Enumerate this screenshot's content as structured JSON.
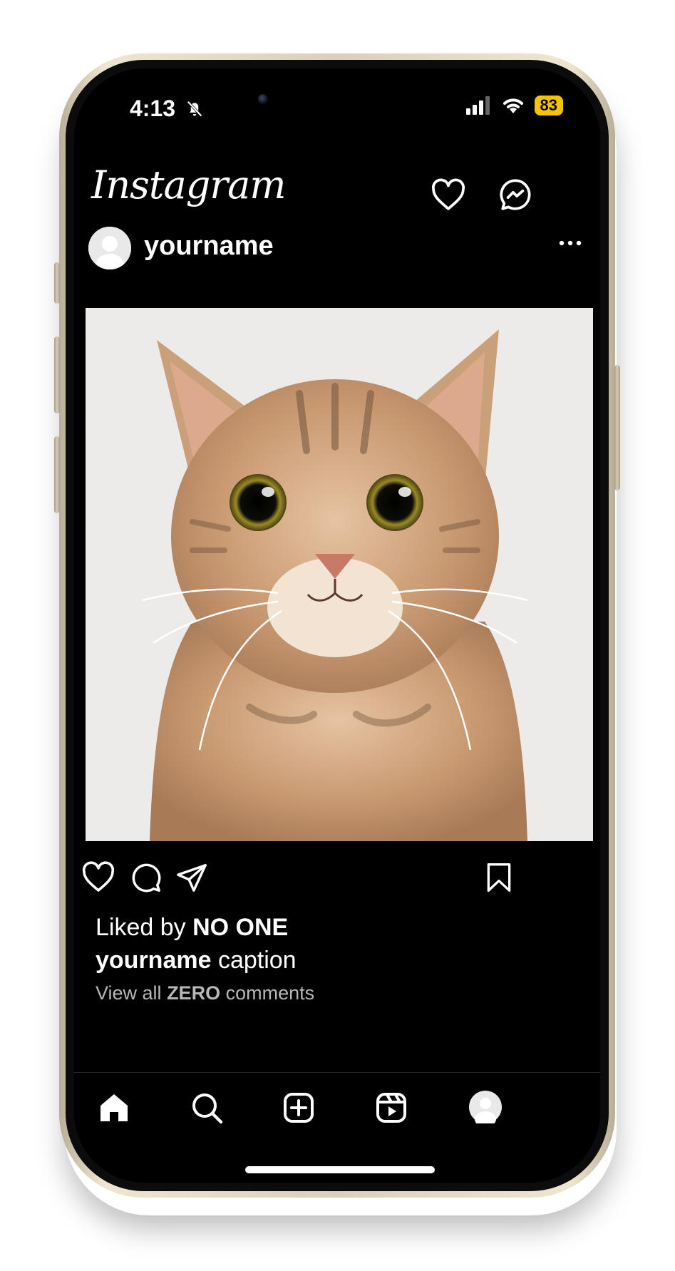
{
  "status_bar": {
    "time": "4:13",
    "battery": "83",
    "icons": [
      "bell-slash-icon",
      "cellular-signal-icon",
      "wifi-icon",
      "battery-icon"
    ]
  },
  "header": {
    "logo": "Instagram",
    "icons": [
      "heart-icon",
      "messenger-icon"
    ]
  },
  "post": {
    "username": "yourname",
    "image": "cat-photo",
    "liked_prefix": "Liked by ",
    "liked_by": "NO ONE",
    "caption_user": "yourname",
    "caption_text": " caption",
    "comments_prefix": "View all ",
    "comments_count": "ZERO",
    "comments_suffix": " comments",
    "actions": [
      "heart-icon",
      "comment-icon",
      "share-icon",
      "bookmark-icon"
    ]
  },
  "tabbar": {
    "items": [
      "home-icon",
      "search-icon",
      "create-icon",
      "reels-icon",
      "profile-avatar"
    ]
  },
  "colors": {
    "background": "#000000",
    "battery": "#f5c400",
    "frame": "#d9cfba"
  }
}
